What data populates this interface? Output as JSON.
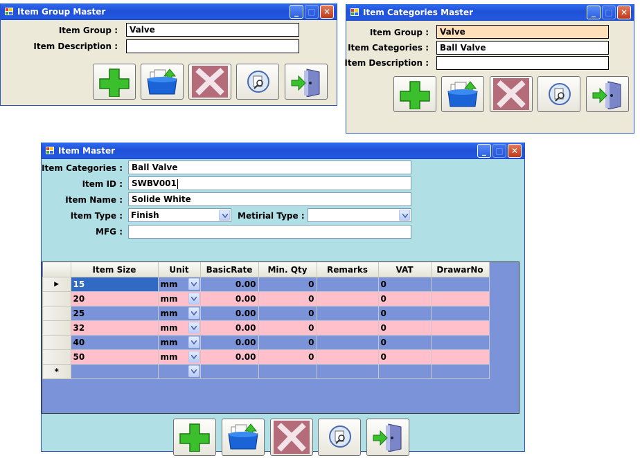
{
  "group_master": {
    "title": "Item Group Master",
    "labels": {
      "item_group": "Item Group :",
      "item_description": "Item Description :"
    },
    "values": {
      "item_group": "Valve",
      "item_description": ""
    }
  },
  "categories_master": {
    "title": "Item Categories Master",
    "labels": {
      "item_group": "Item Group :",
      "item_categories": "Item Categories :",
      "item_description": "Item Description :"
    },
    "values": {
      "item_group": "Valve",
      "item_categories": "Ball Valve",
      "item_description": ""
    }
  },
  "item_master": {
    "title": "Item Master",
    "labels": {
      "item_categories": "Item Categories :",
      "item_id": "Item ID :",
      "item_name": "Item Name :",
      "item_type": "Item Type :",
      "metirial_type": "Metirial Type :",
      "mfg": "MFG :"
    },
    "values": {
      "item_categories": "Ball Valve",
      "item_id": "SWBV001",
      "item_name": "Solide White",
      "item_type": "Finish",
      "metirial_type": "",
      "mfg": ""
    },
    "grid": {
      "columns": [
        "Item Size",
        "Unit",
        "BasicRate",
        "Min. Qty",
        "Remarks",
        "VAT",
        "DrawarNo"
      ],
      "rows": [
        {
          "size": "15",
          "unit": "mm",
          "rate": "0.00",
          "qty": "0",
          "remarks": "",
          "vat": "0",
          "drawar": ""
        },
        {
          "size": "20",
          "unit": "mm",
          "rate": "0.00",
          "qty": "0",
          "remarks": "",
          "vat": "0",
          "drawar": ""
        },
        {
          "size": "25",
          "unit": "mm",
          "rate": "0.00",
          "qty": "0",
          "remarks": "",
          "vat": "0",
          "drawar": ""
        },
        {
          "size": "32",
          "unit": "mm",
          "rate": "0.00",
          "qty": "0",
          "remarks": "",
          "vat": "0",
          "drawar": ""
        },
        {
          "size": "40",
          "unit": "mm",
          "rate": "0.00",
          "qty": "0",
          "remarks": "",
          "vat": "0",
          "drawar": ""
        },
        {
          "size": "50",
          "unit": "mm",
          "rate": "0.00",
          "qty": "0",
          "remarks": "",
          "vat": "0",
          "drawar": ""
        }
      ],
      "current_row_marker": "▶",
      "new_row_marker": "*"
    }
  },
  "colors": {
    "titlebar": "#2458e0",
    "form_bg": "#ece9d8",
    "item_form_bg": "#b0e0e6",
    "pink_row": "#ffc0cb",
    "grid_bg": "#7b93d8",
    "highlight_field": "#ffe0b8"
  },
  "toolbar_icons": [
    "add-icon",
    "open-folder-icon",
    "delete-icon",
    "search-icon",
    "exit-door-icon"
  ]
}
